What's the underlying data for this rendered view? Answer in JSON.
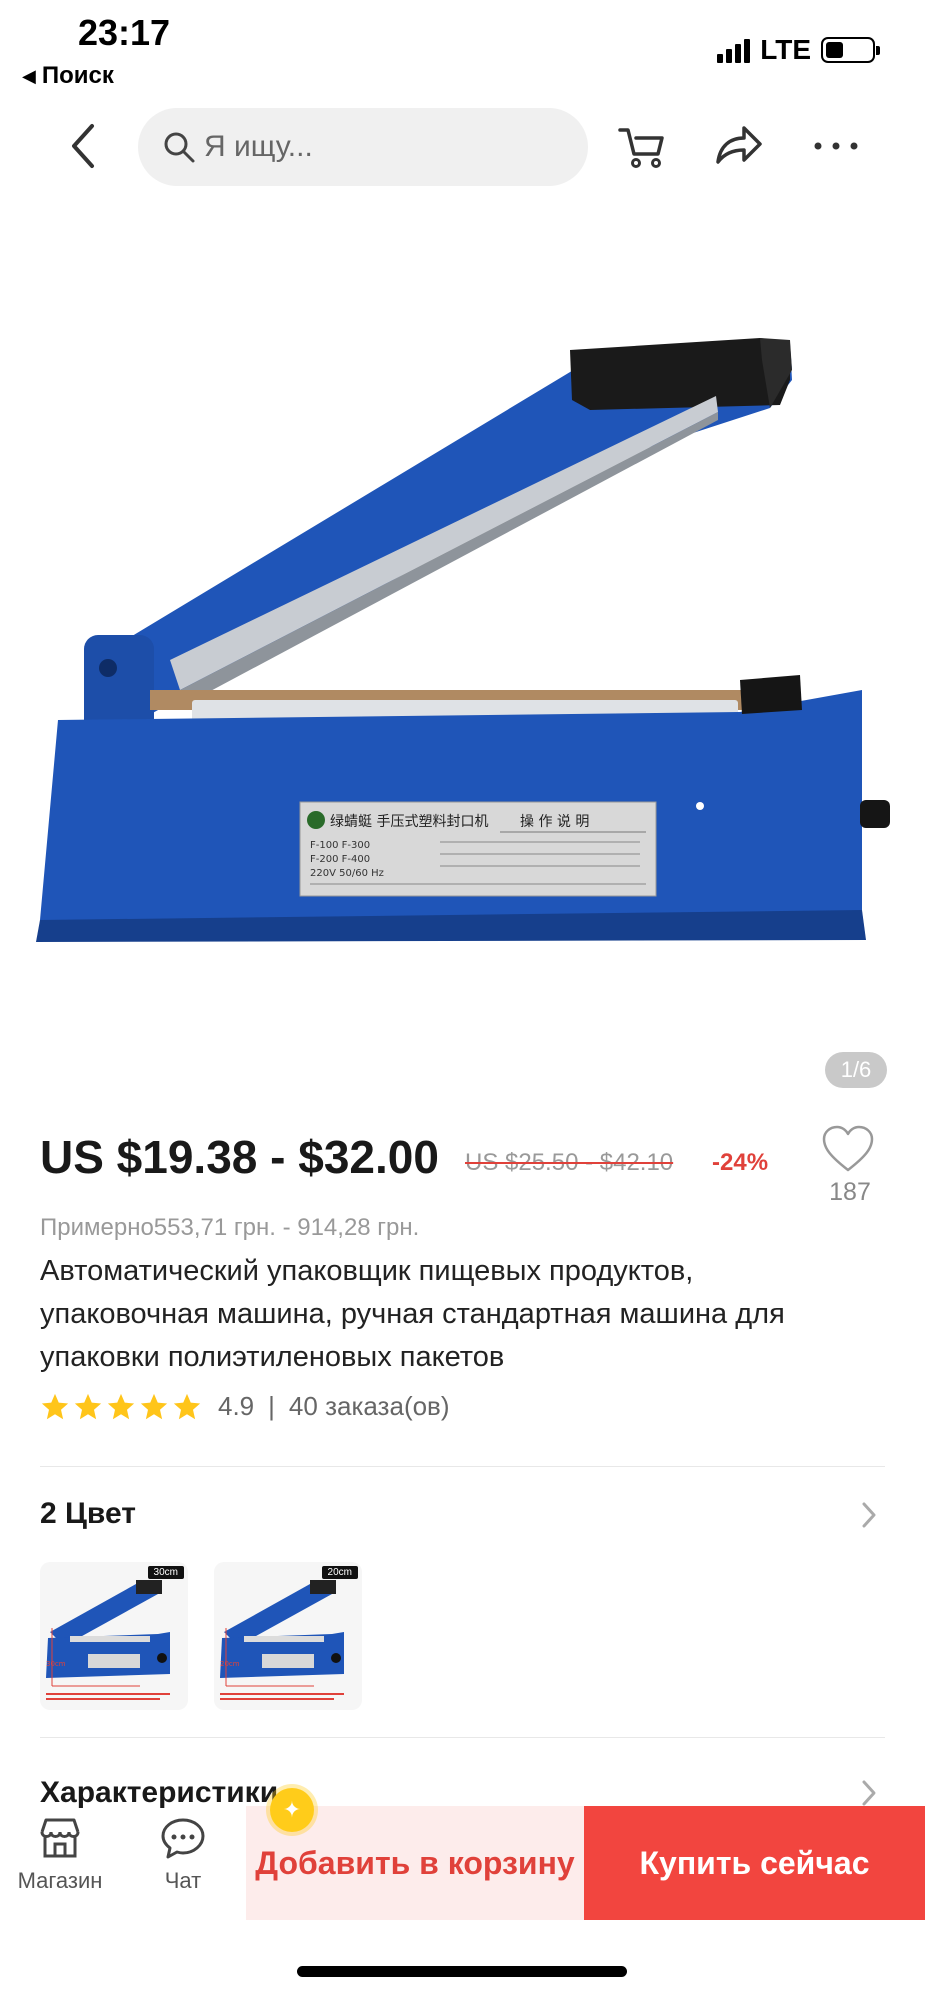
{
  "status": {
    "time": "23:17",
    "back_app": "Поиск",
    "network": "LTE"
  },
  "search": {
    "placeholder": "Я ищу..."
  },
  "gallery": {
    "counter": "1/6",
    "label_text_lines": [
      "绿蜻蜓 手压式塑料封口机",
      "操 作 说 明",
      "F-100  F-300",
      "F-200  F-400",
      "220V 50/60 Hz"
    ]
  },
  "product": {
    "price": "US $19.38 - $32.00",
    "old_price": "US $25.50 - $42.10",
    "discount": "-24%",
    "wishlist_count": "187",
    "approx_price": "Примерно553,71 грн. - 914,28 грн.",
    "title": "Автоматический упаковщик пищевых продуктов, упаковочная машина, ручная стандартная машина для упаковки полиэтиленовых пакетов",
    "rating": "4.9",
    "rating_stars": 5,
    "separator": "|",
    "orders": "40 заказа(ов)"
  },
  "colors": {
    "title": "2 Цвет",
    "options": [
      {
        "tag": "30cm",
        "size_label": "30cm"
      },
      {
        "tag": "20cm",
        "size_label": "20cm"
      }
    ]
  },
  "specs": {
    "title": "Характеристики"
  },
  "bottom": {
    "store_label": "Магазин",
    "chat_label": "Чат",
    "add_to_cart": "Добавить в корзину",
    "buy_now": "Купить сейчас"
  },
  "theme": {
    "accent_red": "#f2453f",
    "star_yellow": "#ffc51a",
    "machine_blue": "#1f55b8"
  }
}
